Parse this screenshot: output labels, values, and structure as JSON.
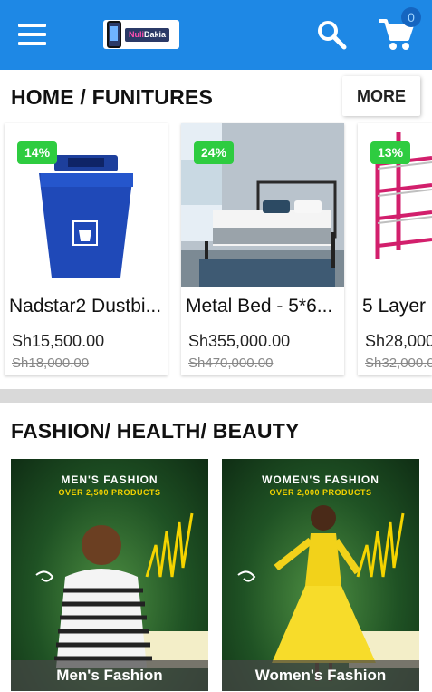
{
  "header": {
    "logo_text_a": "Nuli",
    "logo_text_b": "Dakia",
    "cart_count": "0",
    "icons": [
      "menu-icon",
      "search-icon",
      "cart-icon"
    ]
  },
  "sections": {
    "furniture": {
      "title": "HOME / FUNITURES",
      "more_label": "MORE",
      "products": [
        {
          "name": "Nadstar2 Dustbin",
          "display": "Nadstar2 Dustbi...",
          "discount": "14%",
          "price": "Sh15,500.00",
          "old_price": "Sh18,000.00"
        },
        {
          "name": "Metal Bed - 5*6",
          "display": "Metal Bed - 5*6...",
          "discount": "24%",
          "price": "Sh355,000.00",
          "old_price": "Sh470,000.00"
        },
        {
          "name": "5 Layer",
          "display": "5 Layer",
          "discount": "13%",
          "price": "Sh28,000",
          "old_price": "Sh32,000.0"
        }
      ]
    },
    "fashion": {
      "title": "FASHION/ HEALTH/ BEAUTY",
      "promos": [
        {
          "heading": "MEN'S FASHION",
          "sub": "OVER 2,500 PRODUCTS",
          "label": "Men's Fashion"
        },
        {
          "heading": "WOMEN'S FASHION",
          "sub": "OVER 2,000 PRODUCTS",
          "label": "Women's Fashion"
        }
      ]
    }
  },
  "colors": {
    "appbar": "#1e88e5",
    "discount_badge": "#2ecc40",
    "divider": "#d9d9d9"
  }
}
